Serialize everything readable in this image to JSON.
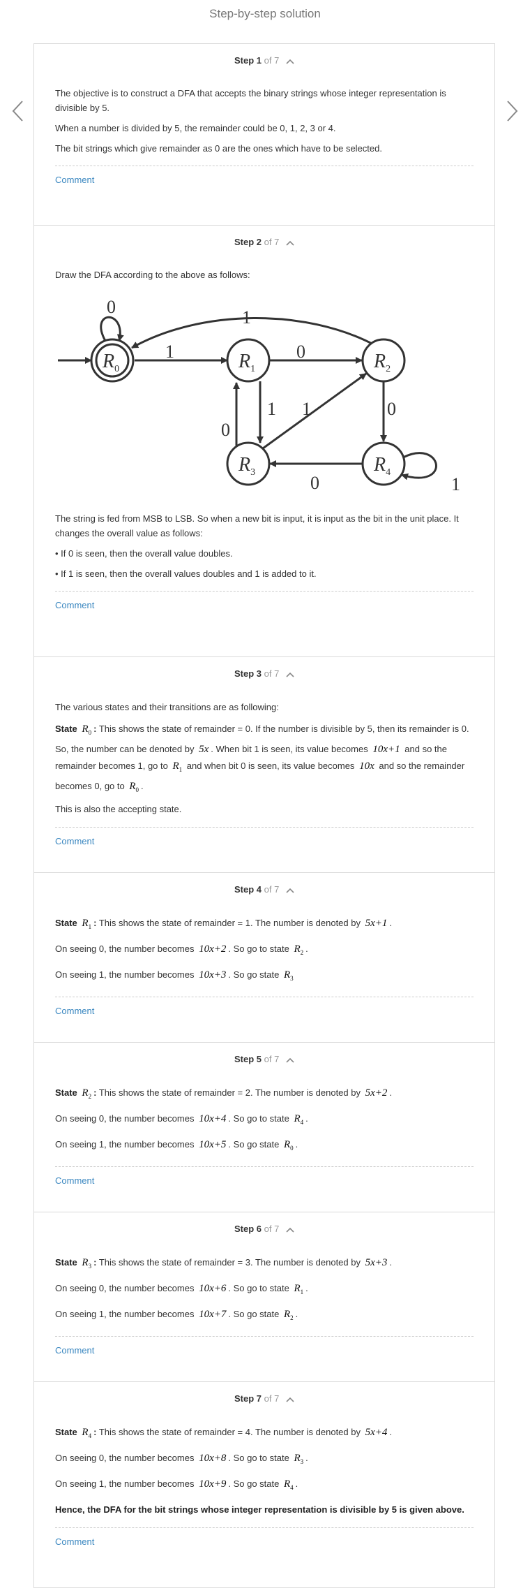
{
  "page": {
    "title": "Step-by-step solution"
  },
  "colors": {
    "link": "#3a87c0",
    "border": "#d9d9d9",
    "muted": "#999999",
    "diagram": "#333333"
  },
  "steps": [
    {
      "label": "Step 1",
      "of": "of 7",
      "paragraphs": [
        "The objective is to construct a DFA that accepts the binary strings whose integer representation is divisible by 5.",
        "When a number is divided by 5, the remainder could be 0, 1, 2, 3 or 4.",
        "The bit strings which give remainder as 0 are the ones which have to be selected."
      ],
      "comment": "Comment"
    },
    {
      "label": "Step 2",
      "of": "of 7",
      "intro": "Draw the DFA according to the above as follows:",
      "diagram": {
        "states": [
          "R0",
          "R1",
          "R2",
          "R3",
          "R4"
        ],
        "state_names": {
          "R0": "R",
          "R1": "R",
          "R2": "R",
          "R3": "R",
          "R4": "R"
        },
        "state_subs": {
          "R0": "0",
          "R1": "1",
          "R2": "2",
          "R3": "3",
          "R4": "4"
        },
        "accepting": "R0",
        "transitions": [
          {
            "from": "R0",
            "to": "R0",
            "symbol": "0"
          },
          {
            "from": "R0",
            "to": "R1",
            "symbol": "1"
          },
          {
            "from": "R1",
            "to": "R2",
            "symbol": "0"
          },
          {
            "from": "R1",
            "to": "R3",
            "symbol": "1"
          },
          {
            "from": "R2",
            "to": "R0",
            "symbol": "1"
          },
          {
            "from": "R2",
            "to": "R4",
            "symbol": "0"
          },
          {
            "from": "R3",
            "to": "R1",
            "symbol": "0"
          },
          {
            "from": "R3",
            "to": "R2",
            "symbol": "1"
          },
          {
            "from": "R4",
            "to": "R3",
            "symbol": "0"
          },
          {
            "from": "R4",
            "to": "R4",
            "symbol": "1"
          }
        ]
      },
      "paragraphs": [
        "The string is fed from MSB to LSB. So when a new bit is input, it is input as the bit in the unit place. It changes the overall value as follows:",
        "• If 0 is seen, then the overall value doubles.",
        "• If 1 is seen, then the overall values doubles and 1 is added to it."
      ],
      "comment": "Comment"
    },
    {
      "label": "Step 3",
      "of": "of 7",
      "intro": "The various states and their transitions are as following:",
      "state_word": "State",
      "state_sym": "R",
      "state_sub": "0",
      "colon": ":",
      "t1": "This shows the state of remainder = 0. If the number is divisible by 5, then its remainder is 0. So, the number can be denoted by",
      "m1": "5x",
      "t2": ". When bit 1 is seen, its value becomes",
      "m2": "10x+1",
      "t3": "and so the remainder becomes 1, go to",
      "r1": "R",
      "r1sub": "1",
      "t4": "and when bit 0 is seen, its value becomes",
      "m3": "10x",
      "t5": "and so the remainder becomes 0, go to",
      "r2": "R",
      "r2sub": "0",
      "t6": ".",
      "extra": "This is also the accepting state.",
      "comment": "Comment"
    },
    {
      "label": "Step 4",
      "of": "of 7",
      "state_word": "State",
      "state_sym": "R",
      "state_sub": "1",
      "colon": ":",
      "desc": "This shows the state of remainder = 1. The number is denoted by",
      "expr": "5x+1",
      "dot": ".",
      "zero_pre": "On seeing 0, the number becomes",
      "zero_expr": "10x+2",
      "zero_mid": ". So go to state",
      "zero_sym": "R",
      "zero_sub": "2",
      "zero_end": ".",
      "one_pre": "On seeing 1, the number becomes",
      "one_expr": "10x+3",
      "one_mid": ". So go state",
      "one_sym": "R",
      "one_sub": "3",
      "one_end": "",
      "comment": "Comment"
    },
    {
      "label": "Step 5",
      "of": "of 7",
      "state_word": "State",
      "state_sym": "R",
      "state_sub": "2",
      "colon": ":",
      "desc": "This shows the state of remainder = 2. The number is denoted by",
      "expr": "5x+2",
      "dot": ".",
      "zero_pre": "On seeing 0, the number becomes",
      "zero_expr": "10x+4",
      "zero_mid": ". So go to state",
      "zero_sym": "R",
      "zero_sub": "4",
      "zero_end": ".",
      "one_pre": "On seeing 1, the number becomes",
      "one_expr": "10x+5",
      "one_mid": ". So go state",
      "one_sym": "R",
      "one_sub": "0",
      "one_end": ".",
      "comment": "Comment"
    },
    {
      "label": "Step 6",
      "of": "of 7",
      "state_word": "State",
      "state_sym": "R",
      "state_sub": "3",
      "colon": ":",
      "desc": "This shows the state of remainder = 3. The number is denoted by",
      "expr": "5x+3",
      "dot": ".",
      "zero_pre": "On seeing 0, the number becomes",
      "zero_expr": "10x+6",
      "zero_mid": ". So go to state",
      "zero_sym": "R",
      "zero_sub": "1",
      "zero_end": ".",
      "one_pre": "On seeing 1, the number becomes",
      "one_expr": "10x+7",
      "one_mid": ". So go state",
      "one_sym": "R",
      "one_sub": "2",
      "one_end": ".",
      "comment": "Comment"
    },
    {
      "label": "Step 7",
      "of": "of 7",
      "state_word": "State",
      "state_sym": "R",
      "state_sub": "4",
      "colon": ":",
      "desc": "This shows the state of remainder = 4. The number is denoted by",
      "expr": "5x+4",
      "dot": ".",
      "zero_pre": "On seeing 0, the number becomes",
      "zero_expr": "10x+8",
      "zero_mid": ". So go to state",
      "zero_sym": "R",
      "zero_sub": "3",
      "zero_end": ".",
      "one_pre": "On seeing 1, the number becomes",
      "one_expr": "10x+9",
      "one_mid": ". So go state",
      "one_sym": "R",
      "one_sub": "4",
      "one_end": ".",
      "conclusion": "Hence, the DFA for the bit strings whose integer representation is divisible by 5 is given above.",
      "comment": "Comment"
    }
  ],
  "nav": {
    "prev_icon": "chevron-left-icon",
    "next_icon": "chevron-right-icon",
    "collapse_icon": "chevron-up-icon"
  }
}
